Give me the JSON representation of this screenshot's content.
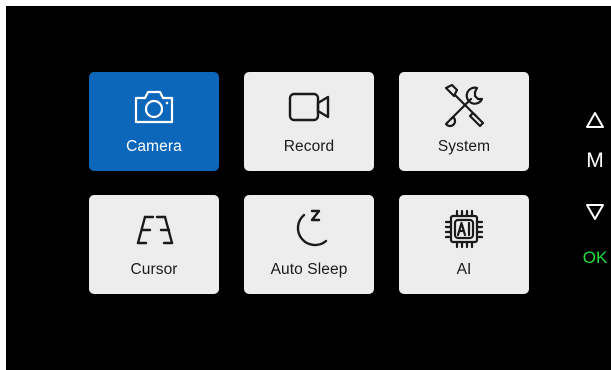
{
  "menu": {
    "items": [
      {
        "label": "Camera",
        "icon": "camera-icon",
        "selected": true
      },
      {
        "label": "Record",
        "icon": "video-camera-icon",
        "selected": false
      },
      {
        "label": "System",
        "icon": "tools-icon",
        "selected": false
      },
      {
        "label": "Cursor",
        "icon": "cursor-guide-icon",
        "selected": false
      },
      {
        "label": "Auto Sleep",
        "icon": "moon-sleep-icon",
        "selected": false
      },
      {
        "label": "AI",
        "icon": "ai-chip-icon",
        "selected": false
      }
    ]
  },
  "side_controls": {
    "up": "up-triangle-icon",
    "mode_label": "M",
    "down": "down-triangle-icon",
    "ok_label": "OK"
  },
  "colors": {
    "background": "#000000",
    "tile": "#ededed",
    "selected_tile": "#0c66b9",
    "ok": "#1fdc3c"
  }
}
